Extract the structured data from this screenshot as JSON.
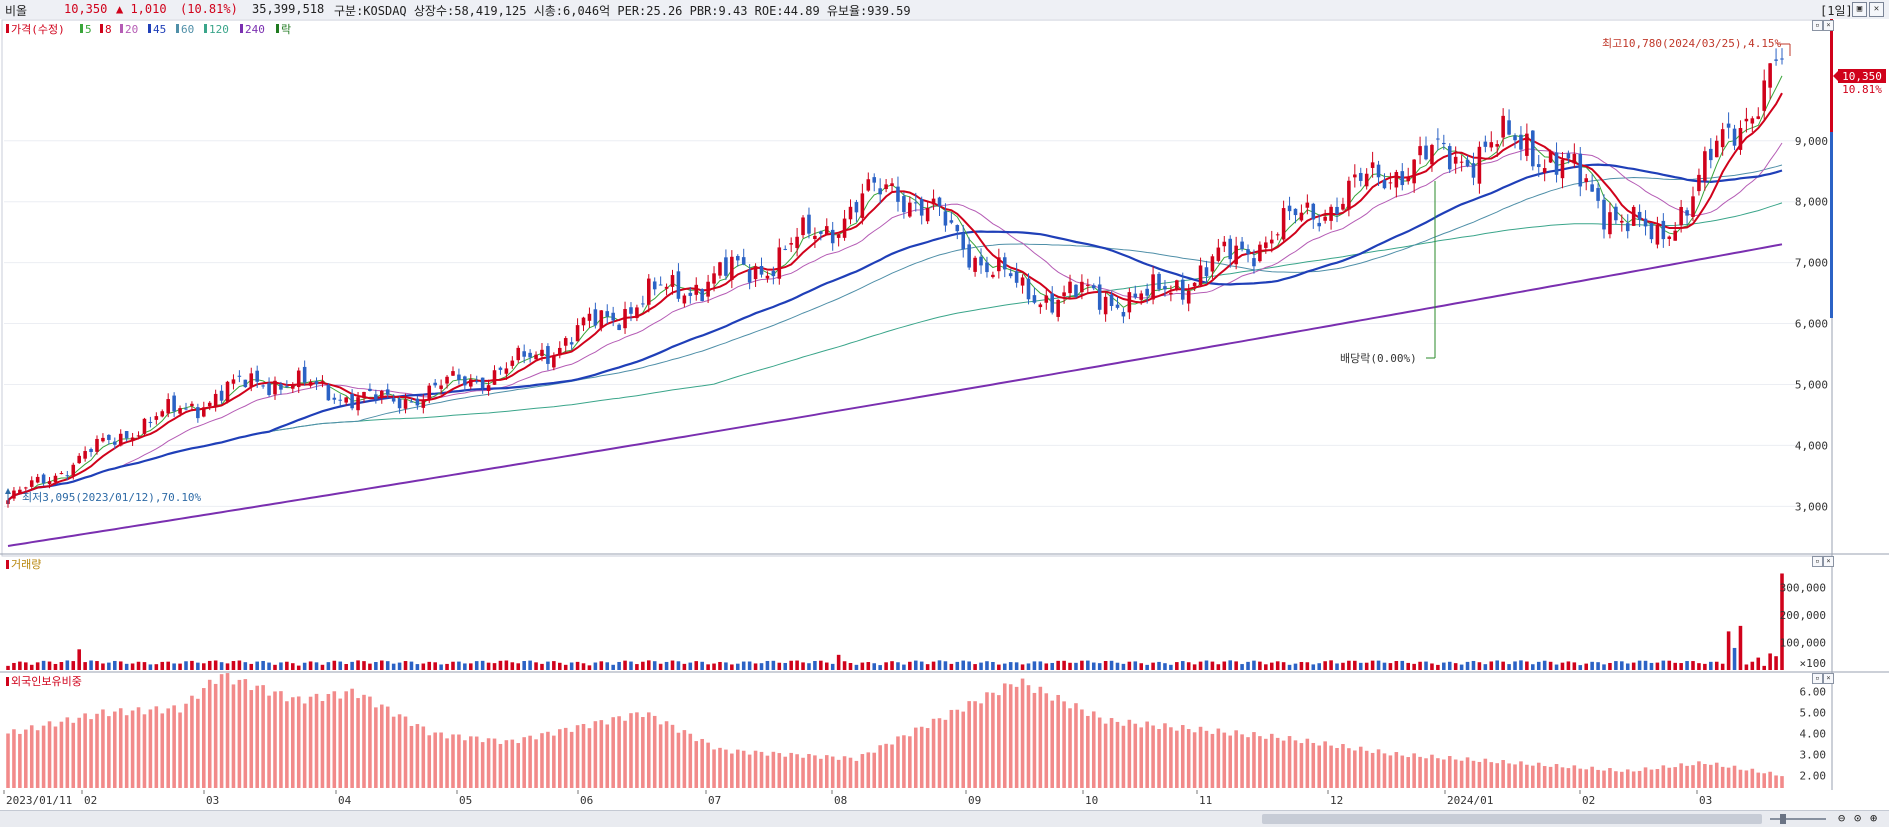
{
  "header": {
    "name": "비올",
    "price": "10,350",
    "change": "▲ 1,010",
    "change_pct": "(10.81%)",
    "volume": "35,399,518",
    "info": "구분:KOSDAQ 상장수:58,419,125 시총:6,046억 PER:25.26 PBR:9.43 ROE:44.89 유보율:939.59",
    "period_button": "[1일]",
    "win_btns": [
      "▣",
      "✕"
    ]
  },
  "legend": {
    "price": "가격(수정)",
    "items": [
      {
        "label": "5",
        "color": "#3aa53a"
      },
      {
        "label": "8",
        "color": "#d0021b"
      },
      {
        "label": "20",
        "color": "#b55cb5"
      },
      {
        "label": "45",
        "color": "#1f3fb8"
      },
      {
        "label": "60",
        "color": "#4f8fa8"
      },
      {
        "label": "120",
        "color": "#3aa58a"
      },
      {
        "label": "240",
        "color": "#7a2fb0"
      },
      {
        "label": "락",
        "color": "#1f7a1f"
      }
    ]
  },
  "annotations": {
    "high": "최고10,780(2024/03/25),4.15%",
    "low": "최저3,095(2023/01/12),70.10%",
    "dividend": "배당락(0.00%)",
    "price_tag": "10,350",
    "pct_tag": "10.81%"
  },
  "volume_panel": {
    "title": "거래량",
    "ticks": [
      "300,000",
      "200,000",
      "100,000",
      "×100"
    ]
  },
  "foreign_panel": {
    "title": "외국인보유비중",
    "ticks": [
      "6.00",
      "5.00",
      "4.00",
      "3.00",
      "2.00"
    ]
  },
  "x_labels": [
    "2023/01/11",
    "02",
    "03",
    "04",
    "05",
    "06",
    "07",
    "08",
    "09",
    "10",
    "11",
    "12",
    "2024/01",
    "02",
    "03"
  ],
  "zoom_icons": [
    "zoom-out-icon",
    "zoom-reset-icon",
    "zoom-in-icon"
  ],
  "chart_data": {
    "type": "candlestick",
    "y_ticks": [
      3000,
      4000,
      5000,
      6000,
      7000,
      8000,
      9000
    ],
    "ylim": [
      2300,
      10900
    ],
    "monthly_path": [
      {
        "x": "2023/01/11",
        "price": 3100
      },
      {
        "x": "2023/02",
        "price": 4300
      },
      {
        "x": "2023/03",
        "price": 5100
      },
      {
        "x": "2023/04",
        "price": 4700
      },
      {
        "x": "2023/05",
        "price": 5300
      },
      {
        "x": "2023/06",
        "price": 6400
      },
      {
        "x": "2023/07",
        "price": 7000
      },
      {
        "x": "2023/08",
        "price": 8300
      },
      {
        "x": "2023/09",
        "price": 6500
      },
      {
        "x": "2023/10",
        "price": 6400
      },
      {
        "x": "2023/11",
        "price": 7500
      },
      {
        "x": "2023/12",
        "price": 8600
      },
      {
        "x": "2024/01",
        "price": 9000
      },
      {
        "x": "2024/02",
        "price": 7300
      },
      {
        "x": "2024/03",
        "price": 10350
      }
    ],
    "ma240_range": [
      2350,
      7300
    ],
    "volume_max": 350000,
    "foreign_ratio_range": [
      2.0,
      6.6
    ]
  }
}
